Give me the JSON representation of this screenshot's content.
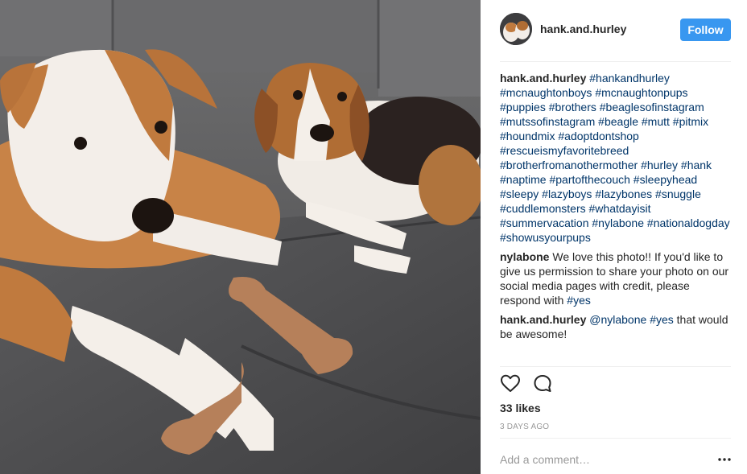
{
  "post": {
    "username": "hank.and.hurley",
    "follow_label": "Follow"
  },
  "caption": {
    "user": "hank.and.hurley",
    "hashtags": [
      "#hankandhurley",
      "#mcnaughtonboys",
      "#mcnaughtonpups",
      "#puppies",
      "#brothers",
      "#beaglesofinstagram",
      "#mutssofinstagram",
      "#beagle",
      "#mutt",
      "#pitmix",
      "#houndmix",
      "#adoptdontshop",
      "#rescueismyfavoritebreed",
      "#brotherfromanothermother",
      "#hurley",
      "#hank",
      "#naptime",
      "#partofthecouch",
      "#sleepyhead",
      "#sleepy",
      "#lazyboys",
      "#lazybones",
      "#snuggle",
      "#cuddlemonsters",
      "#whatdayisit",
      "#summervacation",
      "#nylabone",
      "#nationaldogday",
      "#showusyourpups"
    ]
  },
  "comment1": {
    "user": "nylabone",
    "text": "We love this photo!! If you'd like to give us permission to share your photo on our social media pages with credit, please respond with ",
    "tag": "#yes"
  },
  "comment2": {
    "user": "hank.and.hurley",
    "mention": "@nylabone",
    "tag": "#yes",
    "text": "that would be awesome!"
  },
  "actions": {
    "like_icon": "heart-icon",
    "comment_icon": "speech-bubble-icon"
  },
  "likes_text": "33 likes",
  "timestamp": "3 DAYS AGO",
  "add_comment": {
    "placeholder": "Add a comment…"
  },
  "more_icon": "ellipsis-icon",
  "colors": {
    "follow_button": "#3897f0",
    "hashtag": "#003569",
    "meta_text": "#999999",
    "text": "#262626"
  }
}
